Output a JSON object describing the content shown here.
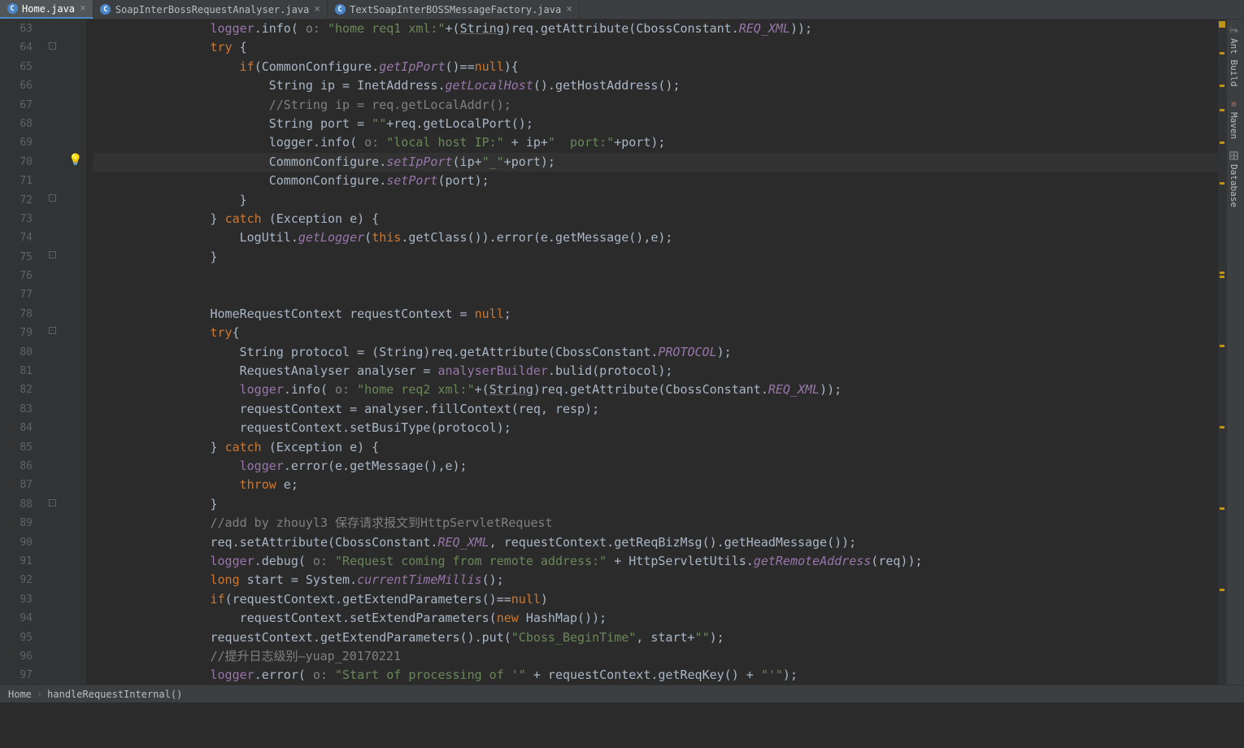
{
  "tabs": [
    {
      "label": "Home.java",
      "active": true
    },
    {
      "label": "SoapInterBossRequestAnalyser.java",
      "active": false
    },
    {
      "label": "TextSoapInterBOSSMessageFactory.java",
      "active": false
    }
  ],
  "rightPanels": [
    {
      "label": "Ant Build"
    },
    {
      "label": "Maven"
    },
    {
      "label": "Database"
    }
  ],
  "breadcrumb": {
    "class": "Home",
    "method": "handleRequestInternal()"
  },
  "gutter": {
    "start": 63,
    "end": 97,
    "bulbLine": 70,
    "currentLine": 70
  },
  "code": {
    "l63": {
      "p0": "logger",
      "p1": ".info(",
      "anno": " o: ",
      "s": "\"home req1 xml:\"",
      "p2": "+(",
      "u": "String",
      "p3": ")req.getAttribute(CbossConstant.",
      "f": "REQ_XML",
      "p4": "));"
    },
    "l64": {
      "kw": "try",
      "p": " {"
    },
    "l65": {
      "kw": "if",
      "p0": "(CommonConfigure.",
      "fn": "getIpPort",
      "p1": "()==",
      "kw2": "null",
      "p2": "){"
    },
    "l66": {
      "t0": "String ip = InetAddress.",
      "fn": "getLocalHost",
      "t1": "().getHostAddress();"
    },
    "l67": {
      "c": "//String ip = req.getLocalAddr();"
    },
    "l68": {
      "t0": "String port = ",
      "s": "\"\"",
      "t1": "+req.getLocalPort();"
    },
    "l69": {
      "t0": "logger.info(",
      "anno": " o: ",
      "s0": "\"local host IP:\"",
      "t1": " + ip+",
      "s1": "\"  port:\"",
      "t2": "+port);"
    },
    "l70": {
      "t0": "CommonConfigure.",
      "fn": "setIpPort",
      "t1": "(ip+",
      "s": "\"_\"",
      "t2": "+port);"
    },
    "l71": {
      "t0": "CommonConfigure.",
      "fn": "setPort",
      "t1": "(port);"
    },
    "l72": {
      "b": "}"
    },
    "l73": {
      "b0": "} ",
      "kw": "catch",
      "t": " (Exception e) {",
      "b1": ""
    },
    "l74": {
      "t0": "LogUtil.",
      "fn": "getLogger",
      "t1": "(",
      "kw": "this",
      "t2": ".getClass()).error(e.getMessage(),e);"
    },
    "l75": {
      "b": "}"
    },
    "l78": {
      "t0": "HomeRequestContext requestContext = ",
      "kw": "null",
      "t1": ";"
    },
    "l79": {
      "kw": "try",
      "b": "{"
    },
    "l80": {
      "t0": "String protocol = (String)req.getAttribute(CbossConstant.",
      "f": "PROTOCOL",
      "t1": ");"
    },
    "l81": {
      "t0": "RequestAnalyser analyser = ",
      "fld": "analyserBuilder",
      "t1": ".bulid(protocol);"
    },
    "l82": {
      "t0": "logger",
      "t0b": ".info(",
      "anno": " o: ",
      "s0": "\"home req2 xml:\"",
      "t1": "+(",
      "u": "String",
      "t2": ")req.getAttribute(CbossConstant.",
      "f": "REQ_XML",
      "t3": "));"
    },
    "l83": {
      "t": "requestContext = analyser.fillContext(req, resp);"
    },
    "l84": {
      "t": "requestContext.setBusiType(protocol);"
    },
    "l85": {
      "b0": "} ",
      "kw": "catch",
      "t": " (Exception e) {"
    },
    "l86": {
      "t0": "logger",
      "t1": ".error(e.getMessage(),e);"
    },
    "l87": {
      "kw": "throw",
      "t": " e;"
    },
    "l88": {
      "b": "}"
    },
    "l89": {
      "c": "//add by zhouyl3 保存请求报文到HttpServletRequest"
    },
    "l90": {
      "t0": "req.setAttribute(CbossConstant.",
      "f": "REQ_XML",
      "t1": ", requestContext.getReqBizMsg().getHeadMessage());"
    },
    "l91": {
      "t0": "logger",
      "t0b": ".debug(",
      "anno": " o: ",
      "s": "\"Request coming from remote address:\"",
      "t1": " + HttpServletUtils.",
      "fn": "getRemoteAddress",
      "t2": "(req));"
    },
    "l92": {
      "kw": "long",
      "t0": " start = System.",
      "fn": "currentTimeMillis",
      "t1": "();"
    },
    "l93": {
      "kw": "if",
      "t0": "(requestContext.getExtendParameters()==",
      "kw2": "null",
      "t1": ")"
    },
    "l94": {
      "t0": "requestContext.setExtendParameters(",
      "kw": "new",
      "t1": " HashMap());"
    },
    "l95": {
      "t0": "requestContext.getExtendParameters().put(",
      "s0": "\"Cboss_BeginTime\"",
      "t1": ", start+",
      "s1": "\"\"",
      "t2": ");"
    },
    "l96": {
      "c": "//提升日志级别—yuap_20170221"
    },
    "l97": {
      "t0": "logger",
      "t0b": ".error(",
      "anno": " o: ",
      "s0": "\"Start of processing of '\"",
      "t1": " + requestContext.getReqKey() + ",
      "s1": "\"'\"",
      "t2": ");"
    }
  }
}
